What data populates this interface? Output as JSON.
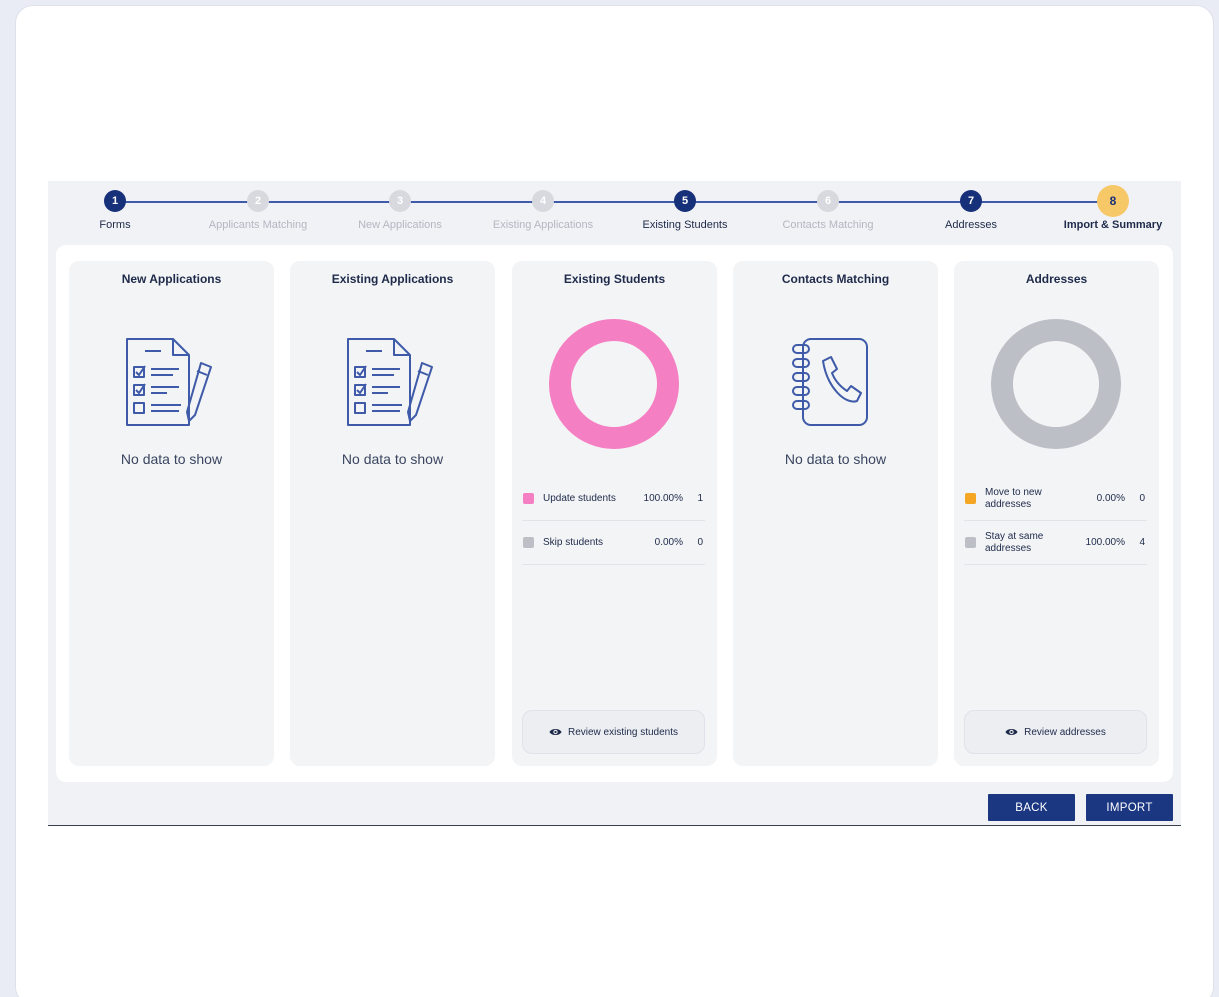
{
  "stepper": {
    "steps": [
      {
        "num": "1",
        "label": "Forms",
        "state": "done"
      },
      {
        "num": "2",
        "label": "Applicants Matching",
        "state": "inactive"
      },
      {
        "num": "3",
        "label": "New Applications",
        "state": "inactive"
      },
      {
        "num": "4",
        "label": "Existing Applications",
        "state": "inactive"
      },
      {
        "num": "5",
        "label": "Existing Students",
        "state": "done"
      },
      {
        "num": "6",
        "label": "Contacts Matching",
        "state": "inactive"
      },
      {
        "num": "7",
        "label": "Addresses",
        "state": "done"
      },
      {
        "num": "8",
        "label": "Import & Summary",
        "state": "current"
      }
    ]
  },
  "panels": {
    "new_applications": {
      "title": "New Applications",
      "empty_text": "No data to show",
      "icon": "checklist-document-icon"
    },
    "existing_applications": {
      "title": "Existing Applications",
      "empty_text": "No data to show",
      "icon": "checklist-document-icon"
    },
    "existing_students": {
      "title": "Existing Students",
      "legend": [
        {
          "label": "Update students",
          "percent": "100.00%",
          "count": "1",
          "color": "#f57fc3",
          "share": 1.0
        },
        {
          "label": "Skip students",
          "percent": "0.00%",
          "count": "0",
          "color": "#bcbfc5",
          "share": 0.0
        }
      ],
      "review_label": "Review existing students",
      "review_icon": "eye-icon"
    },
    "contacts_matching": {
      "title": "Contacts Matching",
      "empty_text": "No data to show",
      "icon": "address-book-phone-icon"
    },
    "addresses": {
      "title": "Addresses",
      "legend": [
        {
          "label": "Move to new addresses",
          "percent": "0.00%",
          "count": "0",
          "color": "#f5a623",
          "share": 0.0
        },
        {
          "label": "Stay at same addresses",
          "percent": "100.00%",
          "count": "4",
          "color": "#bcbfc5",
          "share": 1.0
        }
      ],
      "review_label": "Review addresses",
      "review_icon": "eye-icon"
    }
  },
  "actions": {
    "back_label": "BACK",
    "import_label": "IMPORT"
  },
  "colors": {
    "primary": "#1c3782",
    "step_current": "#f7c868",
    "panel_bg": "#f3f4f6"
  }
}
